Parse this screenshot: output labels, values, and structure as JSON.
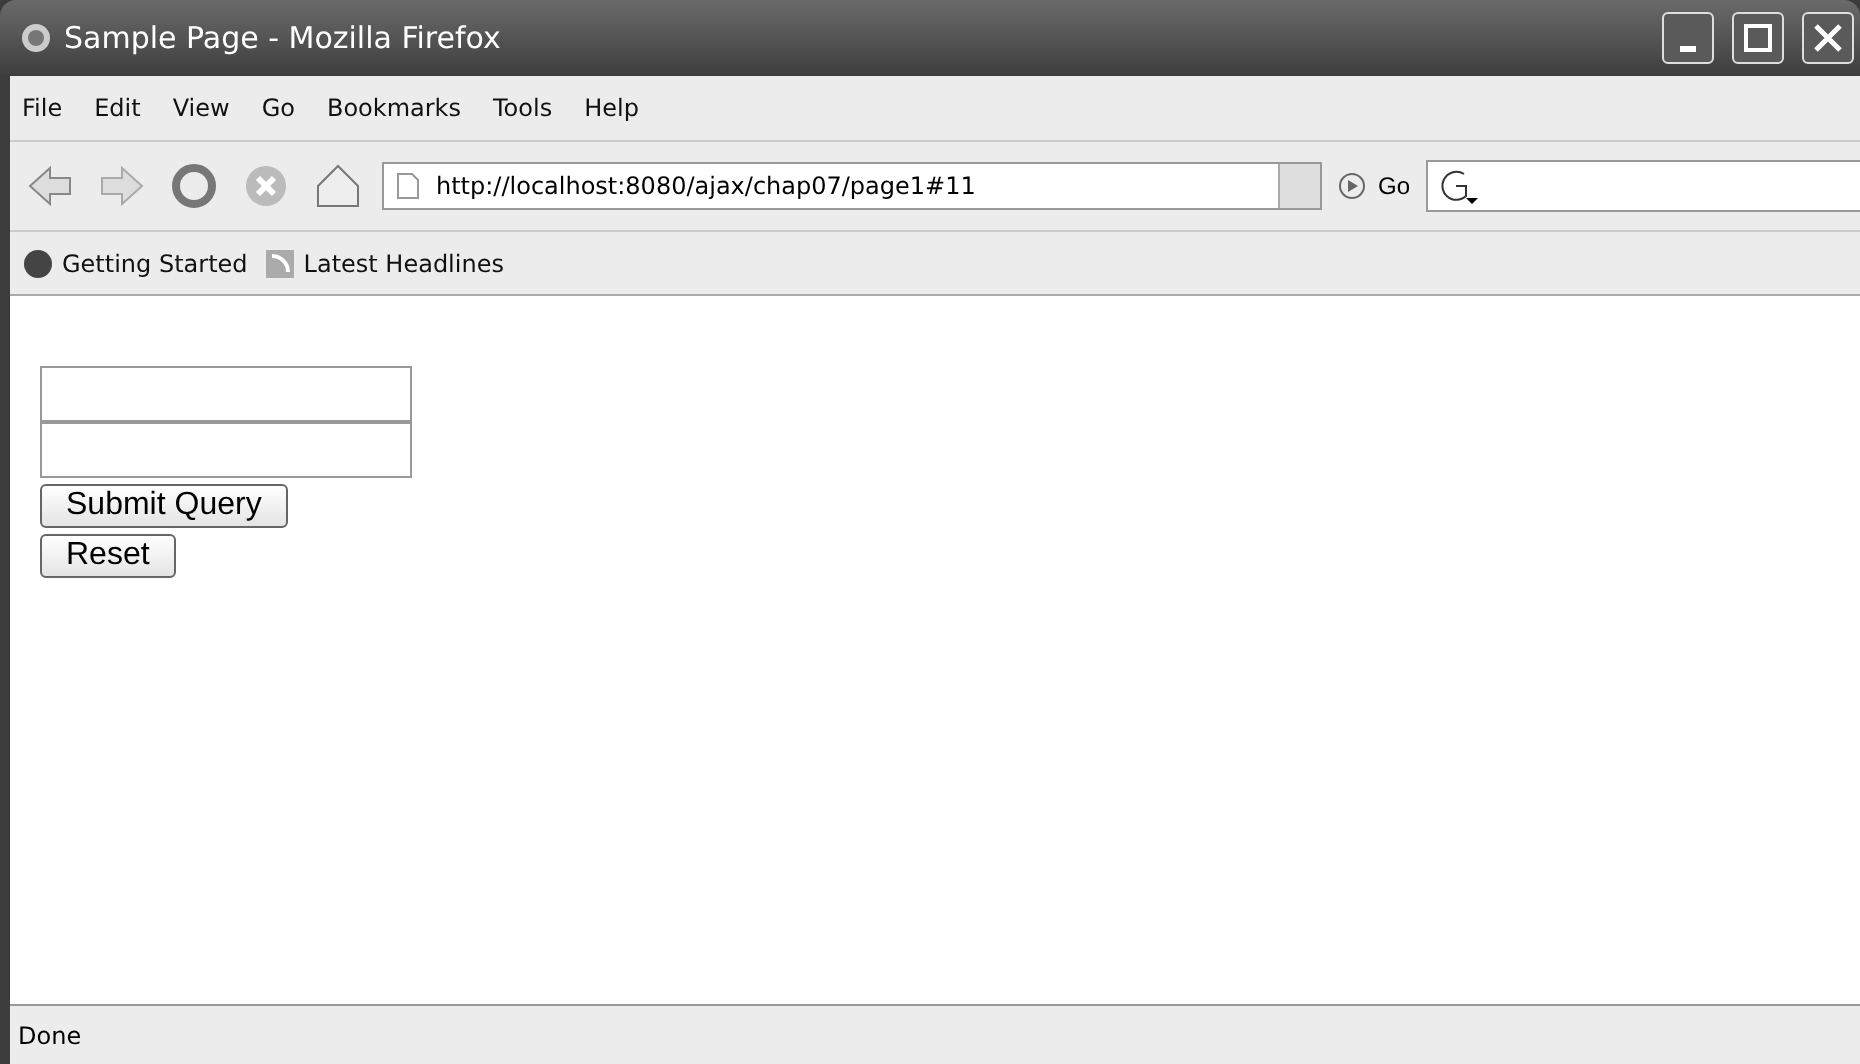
{
  "window": {
    "title": "Sample Page - Mozilla Firefox"
  },
  "menu": [
    "File",
    "Edit",
    "View",
    "Go",
    "Bookmarks",
    "Tools",
    "Help"
  ],
  "address": {
    "value": "http://localhost:8080/ajax/chap07/page1#11"
  },
  "go_label": "Go",
  "bookmarks": [
    {
      "label": "Getting Started",
      "kind": "page"
    },
    {
      "label": "Latest Headlines",
      "kind": "feed"
    }
  ],
  "form": {
    "fields": [
      {
        "kind": "text"
      },
      {
        "kind": "text"
      }
    ],
    "buttons": [
      "Submit Query",
      "Reset"
    ]
  },
  "status_bar": "Done"
}
